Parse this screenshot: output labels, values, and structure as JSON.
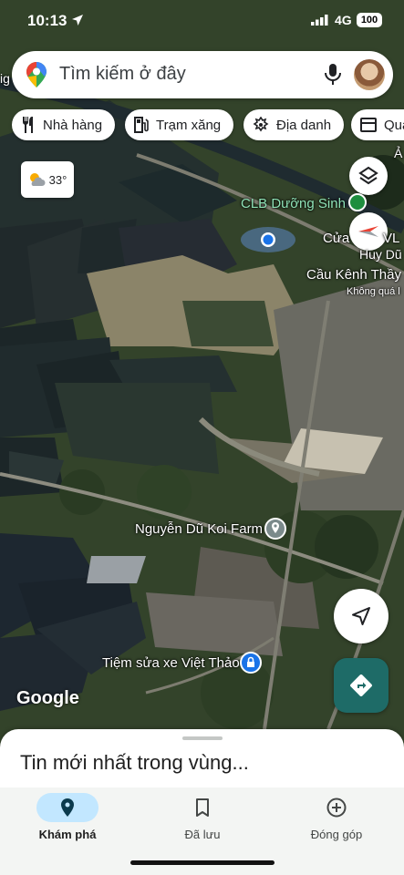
{
  "status_bar": {
    "time": "10:13",
    "network": "4G",
    "battery": "100"
  },
  "search": {
    "placeholder": "Tìm kiếm ở đây"
  },
  "chips": [
    {
      "label": "Nhà hàng",
      "icon": "restaurant-icon"
    },
    {
      "label": "Trạm xăng",
      "icon": "gas-station-icon"
    },
    {
      "label": "Địa danh",
      "icon": "landmark-icon"
    },
    {
      "label": "Qua",
      "icon": "store-icon"
    }
  ],
  "weather": {
    "temp": "33°",
    "icon": "partly-cloudy-icon"
  },
  "map": {
    "edge_text": "Ả",
    "edge_text_left": "ig",
    "places": [
      {
        "name": "CLB Dưỡng Sinh",
        "style": "green"
      },
      {
        "name": "Cửa",
        "style": "white"
      },
      {
        "name": "VL",
        "style": "white"
      },
      {
        "name": "Huy Dũ",
        "style": "white"
      },
      {
        "name": "Cầu Kênh Thầy T",
        "style": "white"
      },
      {
        "name": "Không quá l",
        "style": "small"
      },
      {
        "name": "Nguyễn Dũ Koi Farm",
        "style": "white"
      },
      {
        "name": "Tiệm sửa xe Việt Thảo",
        "style": "white"
      }
    ],
    "attribution": "Google"
  },
  "sheet": {
    "title": "Tin mới nhất trong vùng..."
  },
  "nav": [
    {
      "label": "Khám phá",
      "icon": "explore-pin-icon",
      "active": true
    },
    {
      "label": "Đã lưu",
      "icon": "bookmark-icon",
      "active": false
    },
    {
      "label": "Đóng góp",
      "icon": "add-circle-icon",
      "active": false
    }
  ],
  "colors": {
    "accent": "#1e6b67",
    "nav_active_pill": "#c2e7ff",
    "place_green": "#1e8e3e"
  }
}
